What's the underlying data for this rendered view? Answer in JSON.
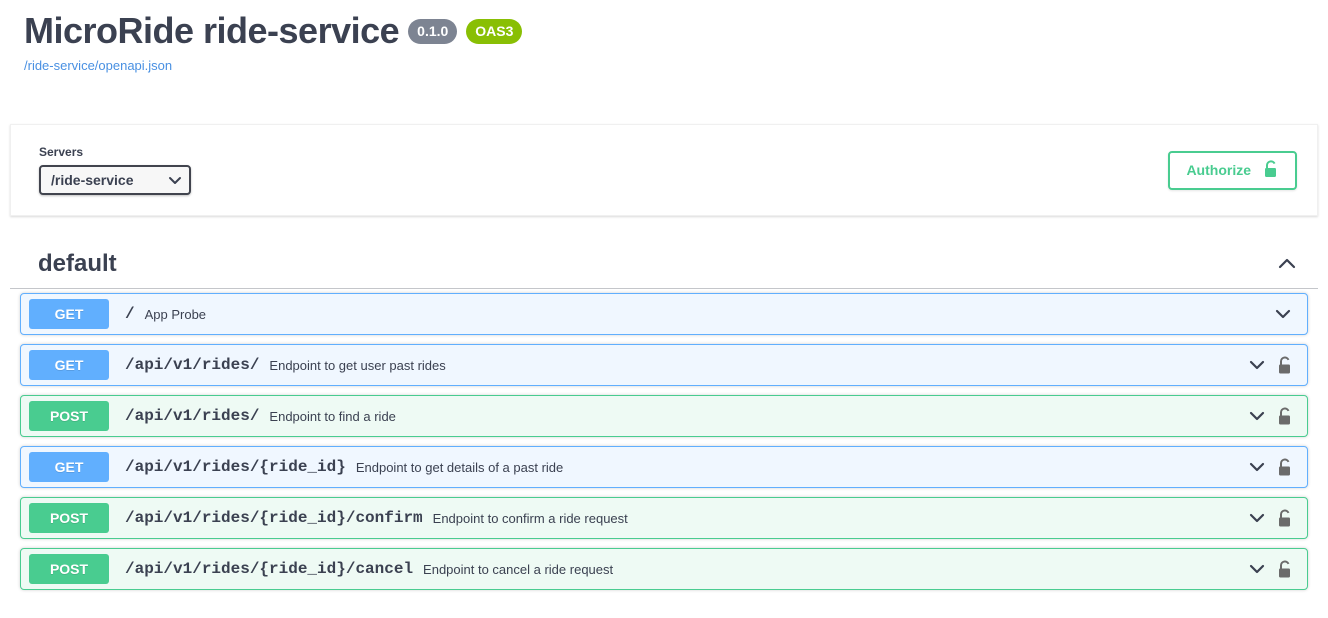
{
  "header": {
    "title": "MicroRide ride-service",
    "version_badge": "0.1.0",
    "spec_badge": "OAS3",
    "spec_url": "/ride-service/openapi.json"
  },
  "scheme": {
    "servers_label": "Servers",
    "selected_server": "/ride-service",
    "server_options": [
      "/ride-service"
    ],
    "authorize_label": "Authorize",
    "authorize_icon": "unlock-icon"
  },
  "tag_section": {
    "name": "default",
    "toggle_icon": "chevron-up-icon"
  },
  "operations": [
    {
      "method": "GET",
      "method_class": "get",
      "path": "/",
      "summary": "App Probe",
      "locked": false,
      "lock_icon": "",
      "chevron_icon": "chevron-down-icon"
    },
    {
      "method": "GET",
      "method_class": "get",
      "path": "/api/v1/rides/",
      "summary": "Endpoint to get user past rides",
      "locked": true,
      "lock_icon": "unlock-icon",
      "chevron_icon": "chevron-down-icon"
    },
    {
      "method": "POST",
      "method_class": "post",
      "path": "/api/v1/rides/",
      "summary": "Endpoint to find a ride",
      "locked": true,
      "lock_icon": "unlock-icon",
      "chevron_icon": "chevron-down-icon"
    },
    {
      "method": "GET",
      "method_class": "get",
      "path": "/api/v1/rides/{ride_id}",
      "summary": "Endpoint to get details of a past ride",
      "locked": true,
      "lock_icon": "unlock-icon",
      "chevron_icon": "chevron-down-icon"
    },
    {
      "method": "POST",
      "method_class": "post",
      "path": "/api/v1/rides/{ride_id}/confirm",
      "summary": "Endpoint to confirm a ride request",
      "locked": true,
      "lock_icon": "unlock-icon",
      "chevron_icon": "chevron-down-icon"
    },
    {
      "method": "POST",
      "method_class": "post",
      "path": "/api/v1/rides/{ride_id}/cancel",
      "summary": "Endpoint to cancel a ride request",
      "locked": true,
      "lock_icon": "unlock-icon",
      "chevron_icon": "chevron-down-icon"
    }
  ],
  "colors": {
    "get": "#61affe",
    "post": "#49cc90",
    "version_badge_bg": "#7d8492",
    "oas_badge_bg": "#89bf04",
    "link": "#4990e2",
    "text": "#3b4151",
    "lock_gray": "#6b6b6b"
  }
}
